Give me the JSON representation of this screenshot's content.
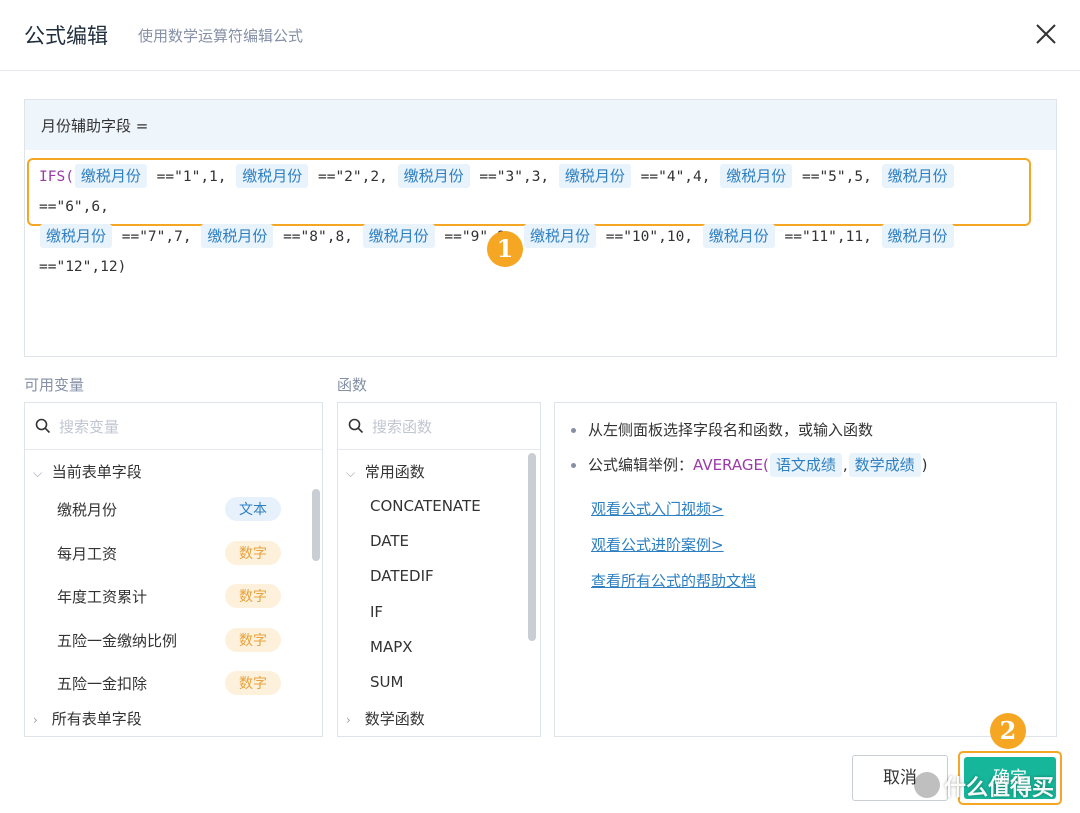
{
  "header": {
    "title": "公式编辑",
    "subtitle": "使用数学运算符编辑公式"
  },
  "editor": {
    "field_label": "月份辅助字段 =",
    "formula_line1": [
      {
        "t": "fn",
        "v": "IFS("
      },
      {
        "t": "tok",
        "v": "缴税月份"
      },
      {
        "t": "txt",
        "v": " ==\"1\",1, "
      },
      {
        "t": "tok",
        "v": "缴税月份"
      },
      {
        "t": "txt",
        "v": " ==\"2\",2, "
      },
      {
        "t": "tok",
        "v": "缴税月份"
      },
      {
        "t": "txt",
        "v": " ==\"3\",3, "
      },
      {
        "t": "tok",
        "v": "缴税月份"
      },
      {
        "t": "txt",
        "v": " ==\"4\",4, "
      },
      {
        "t": "tok",
        "v": "缴税月份"
      },
      {
        "t": "txt",
        "v": " ==\"5\",5, "
      },
      {
        "t": "tok",
        "v": "缴税月份"
      },
      {
        "t": "txt",
        "v": " ==\"6\",6,"
      }
    ],
    "formula_line2": [
      {
        "t": "tok",
        "v": "缴税月份"
      },
      {
        "t": "txt",
        "v": " ==\"7\",7, "
      },
      {
        "t": "tok",
        "v": "缴税月份"
      },
      {
        "t": "txt",
        "v": " ==\"8\",8, "
      },
      {
        "t": "tok",
        "v": "缴税月份"
      },
      {
        "t": "txt",
        "v": " ==\"9\",9, "
      },
      {
        "t": "tok",
        "v": "缴税月份"
      },
      {
        "t": "txt",
        "v": " ==\"10\",10, "
      },
      {
        "t": "tok",
        "v": "缴税月份"
      },
      {
        "t": "txt",
        "v": " ==\"11\",11, "
      },
      {
        "t": "tok",
        "v": "缴税月份"
      },
      {
        "t": "txt",
        "v": " ==\"12\",12)"
      }
    ],
    "marker_1": "1"
  },
  "variables": {
    "label": "可用变量",
    "search_placeholder": "搜索变量",
    "group_current": "当前表单字段",
    "items": [
      {
        "name": "缴税月份",
        "type": "文本",
        "kind": "text"
      },
      {
        "name": "每月工资",
        "type": "数字",
        "kind": "num"
      },
      {
        "name": "年度工资累计",
        "type": "数字",
        "kind": "num"
      },
      {
        "name": "五险一金缴纳比例",
        "type": "数字",
        "kind": "num"
      },
      {
        "name": "五险一金扣除",
        "type": "数字",
        "kind": "num"
      }
    ],
    "group_all": "所有表单字段"
  },
  "functions": {
    "label": "函数",
    "search_placeholder": "搜索函数",
    "group_common": "常用函数",
    "items": [
      "CONCATENATE",
      "DATE",
      "DATEDIF",
      "IF",
      "MAPX",
      "SUM"
    ],
    "group_math": "数学函数"
  },
  "help": {
    "tip1": "从左侧面板选择字段名和函数，或输入函数",
    "tip2_prefix": "公式编辑举例：",
    "tip2_fn": "AVERAGE(",
    "tip2_arg1": "语文成绩",
    "tip2_sep": ",",
    "tip2_arg2": "数学成绩",
    "tip2_close": ")",
    "link1": "观看公式入门视频>",
    "link2": "观看公式进阶案例>",
    "link3": "查看所有公式的帮助文档"
  },
  "footer": {
    "cancel_label": "取消",
    "ok_label": "确定",
    "marker_2": "2",
    "watermark": "什么值得买"
  },
  "colors": {
    "accent": "#16b69a",
    "highlight": "#f5a623",
    "token_bg": "#e9f3fb",
    "token_fg": "#2d7fc1"
  }
}
